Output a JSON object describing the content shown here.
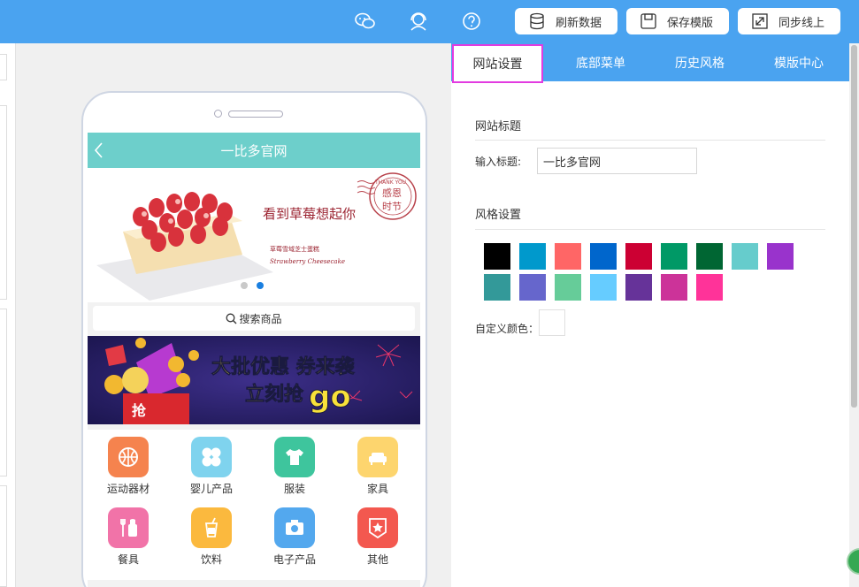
{
  "toolbar": {
    "refresh_label": "刷新数据",
    "save_label": "保存模版",
    "sync_label": "同步线上",
    "icons": [
      "wechat-icon",
      "support-agent-icon",
      "help-icon"
    ]
  },
  "phone": {
    "title": "一比多官网",
    "banner": {
      "headline": "看到草莓想起你",
      "product_cn": "草莓雪域芝士蛋糕",
      "product_en": "Strawberry Cheesecake",
      "stamp_top": "THANK YOU",
      "stamp_main_1": "感恩",
      "stamp_main_2": "时节"
    },
    "search_label": "搜索商品",
    "promo": {
      "line1": "大批优惠 券来袭",
      "line2": "立刻抢",
      "go": "go",
      "grab": "抢"
    },
    "categories": [
      {
        "label": "运动器材",
        "color": "#f5834e"
      },
      {
        "label": "婴儿产品",
        "color": "#7fd3ee"
      },
      {
        "label": "服装",
        "color": "#3ec59d"
      },
      {
        "label": "家具",
        "color": "#fdd56e"
      },
      {
        "label": "餐具",
        "color": "#f173a8"
      },
      {
        "label": "饮料",
        "color": "#fbb93e"
      },
      {
        "label": "电子产品",
        "color": "#53a8ee"
      },
      {
        "label": "其他",
        "color": "#f3584f"
      }
    ]
  },
  "tabs": [
    {
      "label": "网站设置",
      "active": true
    },
    {
      "label": "底部菜单",
      "active": false
    },
    {
      "label": "历史风格",
      "active": false
    },
    {
      "label": "模版中心",
      "active": false
    }
  ],
  "settings": {
    "site_title_heading": "网站标题",
    "input_title_label": "输入标题:",
    "input_title_value": "一比多官网",
    "style_heading": "风格设置",
    "custom_color_label": "自定义颜色：",
    "swatches": [
      "#000000",
      "#0099cc",
      "#ff6666",
      "#0066cc",
      "#cc0033",
      "#009966",
      "#006633",
      "#66cccc",
      "#9933cc",
      "#339999",
      "#6666cc",
      "#66cc99",
      "#66ccff",
      "#663399",
      "#cc3399",
      "#ff3399"
    ]
  },
  "colors": {
    "brand_blue": "#4aa3f0",
    "app_bar": "#6dcfcb",
    "active_tab_border": "#e23be0"
  }
}
